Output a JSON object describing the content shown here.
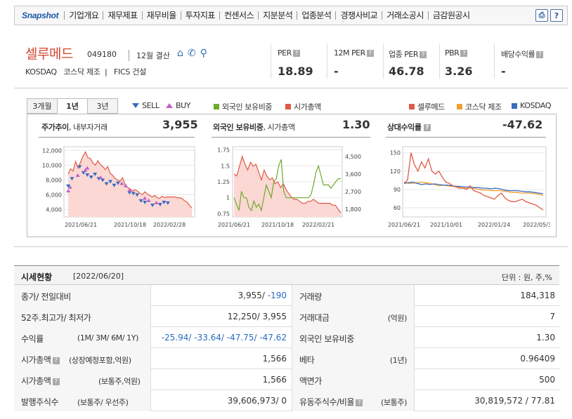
{
  "nav": {
    "logo": "Snapshot",
    "items": [
      "기업개요",
      "재무제표",
      "재무비율",
      "투자지표",
      "컨센서스",
      "지분분석",
      "업종분석",
      "경쟁사비교",
      "거래소공시",
      "금감원공시"
    ]
  },
  "company": {
    "name": "셀루메드",
    "code": "049180",
    "settlement": "12월 결산",
    "market": "KOSDAQ",
    "kosdaq_sector": "코스닥 제조",
    "fics": "FICS 건설"
  },
  "ratios": [
    {
      "label": "PER",
      "value": "18.89",
      "info": true
    },
    {
      "label": "12M PER",
      "value": "-",
      "info": true
    },
    {
      "label": "업종 PER",
      "value": "46.78",
      "info": true
    },
    {
      "label": "PBR",
      "value": "3.26",
      "info": true
    },
    {
      "label": "배당수익률",
      "value": "-",
      "info": true
    }
  ],
  "chart_tabs": [
    "3개월",
    "1년",
    "3년"
  ],
  "chart_tab_selected": "1년",
  "legends": {
    "sell": "SELL",
    "buy": "BUY",
    "foreign": "외국인 보유비중",
    "mcap": "시가총액",
    "stock": "셀루메드",
    "sector": "코스닥 제조",
    "kosdaq": "KOSDAQ"
  },
  "colors": {
    "red": "#e05a47",
    "green": "#6cab2c",
    "orange": "#f0a030",
    "blue": "#3a6cc0",
    "sell": "#3a6cc0",
    "buy": "#c060c8"
  },
  "panels": {
    "p1": {
      "title": "주가추이",
      "subtitle": ", 내부자거래",
      "value": "3,955"
    },
    "p2": {
      "title": "외국인 보유비중",
      "subtitle": ", 시가총액",
      "value": "1.30"
    },
    "p3": {
      "title": "상대수익률",
      "value": "-47.62"
    }
  },
  "chart_data": [
    {
      "type": "area",
      "x_ticks": [
        "2021/06/21",
        "2021/10/18",
        "2022/02/28"
      ],
      "y_ticks": [
        4000,
        6000,
        8000,
        10000,
        12000
      ],
      "ylim": [
        3000,
        12500
      ],
      "y_tick_labels": [
        "4,000",
        "6,000",
        "8,000",
        "10,000",
        "12,000"
      ],
      "series": [
        {
          "values": [
            8800,
            9500,
            9200,
            10500,
            9600,
            10400,
            11200,
            11800,
            11000,
            10900,
            10300,
            10000,
            10600,
            10100,
            9800,
            9400,
            9800,
            8900,
            8600,
            8200,
            8000,
            7800,
            8300,
            7400,
            7000,
            6800,
            6500,
            6700,
            6500,
            6200,
            6000,
            6400,
            6100,
            5900,
            5700,
            5900,
            5600,
            5500,
            5800,
            5600,
            5700,
            5700,
            5700,
            5700,
            5600,
            5600,
            5500,
            5200,
            5000,
            4600,
            4200
          ]
        }
      ],
      "markers": {
        "sell_count": 22,
        "buy_count": 12
      }
    },
    {
      "type": "line",
      "x_ticks": [
        "2021/06/21",
        "2021/10/18",
        "2022/02/21"
      ],
      "y_left_ticks": [
        "0.75",
        "1",
        "1.25",
        "1.5",
        "1.75"
      ],
      "ylim_left": [
        0.7,
        1.8
      ],
      "y_right_ticks": [
        "1,800",
        "2,700",
        "3,600",
        "4,500"
      ],
      "ylim_right": [
        1400,
        5000
      ],
      "series": [
        {
          "values": [
            1.0,
            0.9,
            0.8,
            1.1,
            1.0,
            1.0,
            0.85,
            0.8,
            0.95,
            0.85,
            0.9,
            0.8,
            1.0,
            1.2,
            1.1,
            1.0,
            1.25,
            1.3,
            1.5,
            1.6,
            1.1,
            1.0,
            1.0,
            1.0,
            1.0,
            1.0,
            1.0,
            1.0,
            1.0,
            1.0,
            1.0,
            1.05,
            1.2,
            1.4,
            1.5,
            1.35,
            1.2,
            1.2,
            1.2,
            1.15,
            1.2,
            1.25,
            1.3,
            1.3
          ]
        },
        {
          "values": [
            3600,
            3500,
            4000,
            4500,
            4100,
            3800,
            4200,
            4000,
            4100,
            3700,
            3300,
            3800,
            3500,
            3300,
            3400,
            3100,
            3200,
            2900,
            3100,
            2800,
            2600,
            2400,
            2300,
            2300,
            2200,
            2100,
            2100,
            2200,
            2200,
            2300,
            2200,
            2100,
            2100,
            2100,
            2100,
            2100,
            2000,
            2000,
            1800,
            1600
          ]
        }
      ]
    },
    {
      "type": "line",
      "x_ticks": [
        "2021/06/21",
        "2021/10/01",
        "2022/01/24",
        "2022/05/30"
      ],
      "y_ticks": [
        60,
        90,
        120,
        150
      ],
      "ylim": [
        45,
        160
      ],
      "series": [
        {
          "values": [
            100,
            105,
            150,
            130,
            120,
            135,
            125,
            140,
            120,
            115,
            120,
            110,
            102,
            100,
            96,
            94,
            92,
            92,
            90,
            96,
            88,
            86,
            84,
            80,
            78,
            76,
            74,
            80,
            84,
            76,
            72,
            70,
            70,
            72,
            74,
            70,
            68,
            66,
            64,
            60,
            56
          ]
        },
        {
          "values": [
            102,
            100,
            100,
            101,
            102,
            101,
            100,
            98,
            96,
            97,
            96,
            95,
            94,
            93,
            92,
            92,
            92,
            90,
            89,
            89,
            88,
            88,
            88,
            87,
            86,
            85,
            85,
            84,
            84,
            84,
            83,
            82,
            80
          ]
        },
        {
          "values": [
            100,
            101,
            102,
            100,
            98,
            99,
            98,
            99,
            98,
            97,
            97,
            96,
            95,
            95,
            94,
            94,
            93,
            93,
            92,
            92,
            91,
            92,
            91,
            89,
            88,
            88,
            88,
            87,
            86,
            86,
            85,
            84,
            83
          ]
        }
      ]
    }
  ],
  "market": {
    "title": "시세현황",
    "date": "[2022/06/20]",
    "unit": "단위 : 원, 주,%",
    "rows": [
      {
        "l1": "종가/ 전일대비",
        "s1": "",
        "v1a": "3,955/ ",
        "v1b": "-190",
        "l2": "거래량",
        "s2": "",
        "v2": "184,318"
      },
      {
        "l1": "52주.최고가/ 최저가",
        "s1": "",
        "v1a": "12,250/ 3,955",
        "v1b": "",
        "l2": "거래대금",
        "s2": "(억원)",
        "v2": "7"
      },
      {
        "l1": "수익률",
        "s1": "(1M/ 3M/ 6M/ 1Y)",
        "v1a": "",
        "v1b": "-25.94/ -33.64/ -47.75/ -47.62",
        "l2": "외국인 보유비중",
        "s2": "",
        "v2": "1.30"
      },
      {
        "l1": "시가총액",
        "s1": "(상장예정포함,억원)",
        "v1a": "1,566",
        "v1b": "",
        "l2": "베타",
        "s2": "(1년)",
        "v2": "0.96409",
        "info1": true
      },
      {
        "l1": "시가총액",
        "s1": "(보통주,억원)",
        "v1a": "1,566",
        "v1b": "",
        "l2": "액면가",
        "s2": "",
        "v2": "500",
        "info1": true
      },
      {
        "l1": "발행주식수",
        "s1": "(보통주/ 우선주)",
        "v1a": "39,606,973/ 0",
        "v1b": "",
        "l2": "유동주식수/비율",
        "s2": "(보통주)",
        "v2": "30,819,572 / 77.81",
        "info2": true
      }
    ]
  }
}
